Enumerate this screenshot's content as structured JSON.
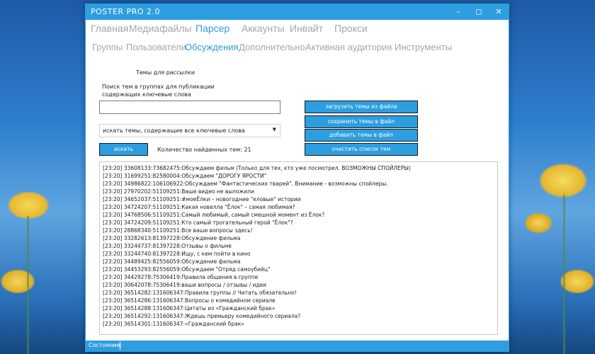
{
  "window": {
    "title": "POSTER PRO 2.0"
  },
  "titlebar_buttons": {
    "minimize": "–",
    "maximize": "◻",
    "close": "✕"
  },
  "menu_primary": [
    "Главная",
    "Медиафайлы",
    "Парсер",
    "Аккаунты",
    "Инвайт",
    "Прокси"
  ],
  "menu_primary_active": "Парсер",
  "menu_secondary": [
    "Группы",
    "Пользователи",
    "Обсуждения",
    "Дополнительно",
    "Активная аудитория",
    "Инструменты"
  ],
  "menu_secondary_active": "Обсуждения",
  "section_title": "Темы для рассылки",
  "description_line1": "Поиск тем в группах для публикации",
  "description_line2": "содержащих ключевые слова",
  "search_input_value": "",
  "mode_select_value": "искать темы, содержащие все ключевые слова",
  "search_button": "искать",
  "found_count_label": "Количество найденных тем: 21",
  "actions": {
    "load": "загрузить темы из файла",
    "save": "сохранить темы в файл",
    "add": "добавить темы в файл",
    "clear": "очистить список тем"
  },
  "log_lines": [
    "[23:20] 33608133:73682475:Обсуждаем фильм (Только для тех, кто уже посмотрел. ВОЗМОЖНЫ СПОЙЛЕРЫ)",
    "[23:20] 31699251:82580004:Обсуждаем \"ДОРОГУ ЯРОСТИ\"",
    "[23:20] 34986822:106106922:Обсуждаем \"Фантастических тварей\". Внимание - возможны спойлеры.",
    "[23:20] 27970202:51109251:Ваше видео не выложили",
    "[23:20] 34652037:51109251:#моеЁлки – новогодние \"еловые\" истории",
    "[23:20] 34724207:51109251:Какая новелла \"Ёлок\" – самая любимая?",
    "[23:20] 34768506:51109251:Самый любимый, самый смешной момент из Ёлок?",
    "[23:20] 34724209:51109251:Кто самый трогательный герой \"Ёлок\"?",
    "[23:20] 28868340:51109251:Все ваши вопросы здесь!",
    "[23:20] 33282613:81397228:Обсуждение фильма",
    "[23:20] 33244737:81397228:Отзывы о фильме",
    "[23:20] 33244740:81397228:Ищу, с кем пойти в кино",
    "[23:20] 34489425:82556059:Обсуждение фильма",
    "[23:20] 34453293:82556059:Обсуждаем \"Отряд самоубийц\"",
    "[23:20] 34429278:75306419:Правила общения в группе",
    "[23:20] 30642078:75306419:ваши вопросы / отзывы / идеи",
    "[23:20] 36514282:131606347:Правила группы // Читать обязательно!",
    "[23:20] 36514286:131606347:Вопросы о комедийном сериале",
    "[23:20] 36514288:131606347:Цитаты из «Гражданский брак»",
    "[23:20] 36514292:131606347:Ждешь премьеру комедийного сериала?",
    "[23:20] 36514301:131606347:«Гражданский брак»"
  ],
  "status_label": "Состояние:",
  "colors": {
    "accent": "#2d9ee0",
    "inactive_menu": "#a6a6a6"
  }
}
